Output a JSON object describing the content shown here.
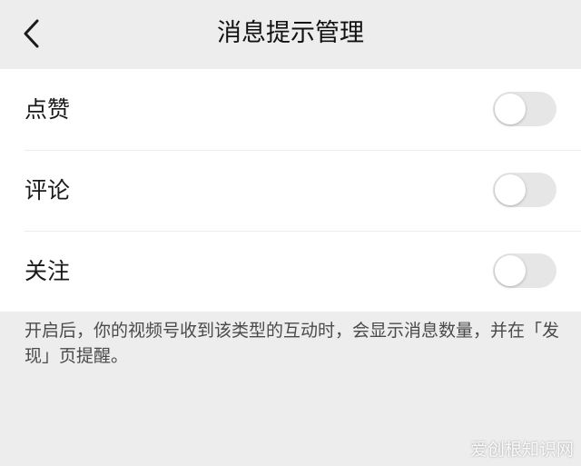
{
  "header": {
    "title": "消息提示管理",
    "back_icon": "chevron-left-icon"
  },
  "settings": {
    "items": [
      {
        "label": "点赞",
        "enabled": false
      },
      {
        "label": "评论",
        "enabled": false
      },
      {
        "label": "关注",
        "enabled": false
      }
    ]
  },
  "hint_text": "开启后，你的视频号收到该类型的互动时，会显示消息数量，并在「发现」页提醒。",
  "watermark": "爱创根知识网",
  "colors": {
    "background": "#ededed",
    "card": "#ffffff",
    "toggle_off": "#e6e6e6"
  }
}
